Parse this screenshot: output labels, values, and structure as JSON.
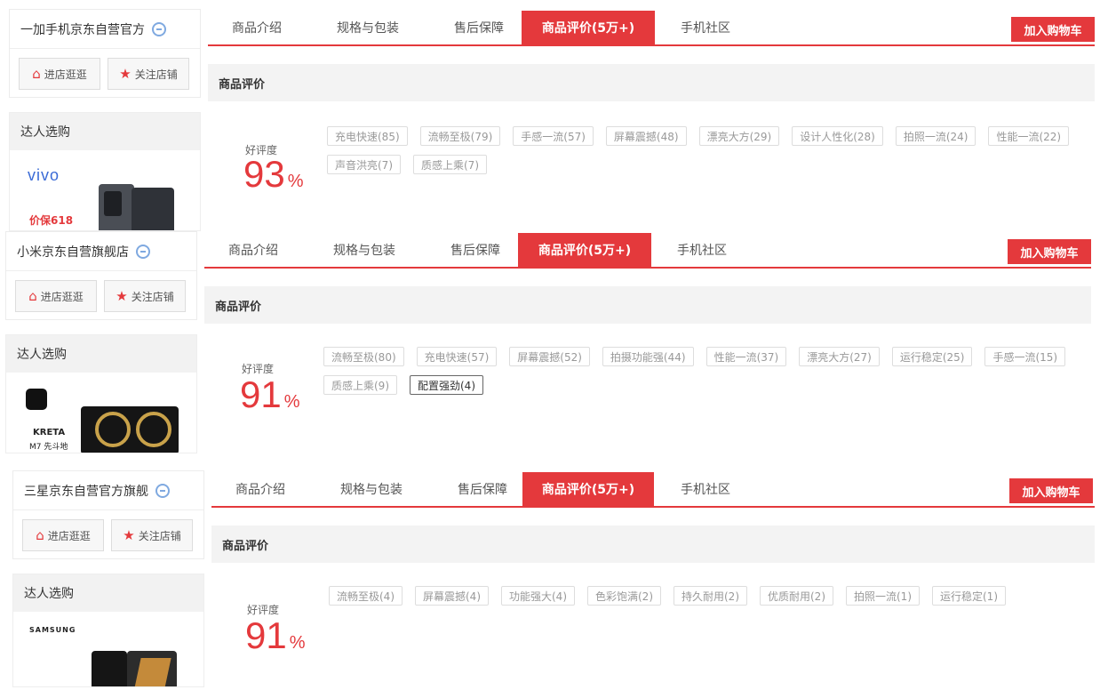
{
  "panels": [
    {
      "shop": {
        "name": "一加手机京东自营官方",
        "btn_enter": "进店逛逛",
        "btn_follow": "关注店铺"
      },
      "daren": {
        "title": "达人选购",
        "brand": "vivo",
        "promo": "价保618"
      },
      "tabs": [
        "商品介绍",
        "规格与包装",
        "售后保障",
        "商品评价(5万+)",
        "手机社区"
      ],
      "cart_label": "加入购物车",
      "section_title": "商品评价",
      "rate_label": "好评度",
      "rate_value": "93",
      "rate_unit": "%",
      "tags": [
        "充电快速(85)",
        "流畅至极(79)",
        "手感一流(57)",
        "屏幕震撼(48)",
        "漂亮大方(29)",
        "设计人性化(28)",
        "拍照一流(24)",
        "性能一流(22)",
        "声音洪亮(7)",
        "质感上乘(7)"
      ]
    },
    {
      "shop": {
        "name": "小米京东自营旗舰店",
        "btn_enter": "进店逛逛",
        "btn_follow": "关注店铺"
      },
      "daren": {
        "title": "达人选购",
        "brand": "KRETA",
        "promo": "M7 先斗地"
      },
      "tabs": [
        "商品介绍",
        "规格与包装",
        "售后保障",
        "商品评价(5万+)",
        "手机社区"
      ],
      "cart_label": "加入购物车",
      "section_title": "商品评价",
      "rate_label": "好评度",
      "rate_value": "91",
      "rate_unit": "%",
      "tags": [
        "流畅至极(80)",
        "充电快速(57)",
        "屏幕震撼(52)",
        "拍摄功能强(44)",
        "性能一流(37)",
        "漂亮大方(27)",
        "运行稳定(25)",
        "手感一流(15)",
        "质感上乘(9)",
        "配置强劲(4)"
      ]
    },
    {
      "shop": {
        "name": "三星京东自营官方旗舰",
        "btn_enter": "进店逛逛",
        "btn_follow": "关注店铺"
      },
      "daren": {
        "title": "达人选购",
        "brand": "SAMSUNG",
        "promo": ""
      },
      "tabs": [
        "商品介绍",
        "规格与包装",
        "售后保障",
        "商品评价(5万+)",
        "手机社区"
      ],
      "cart_label": "加入购物车",
      "section_title": "商品评价",
      "rate_label": "好评度",
      "rate_value": "91",
      "rate_unit": "%",
      "tags": [
        "流畅至极(4)",
        "屏幕震撼(4)",
        "功能强大(4)",
        "色彩饱满(2)",
        "持久耐用(2)",
        "优质耐用(2)",
        "拍照一流(1)",
        "运行稳定(1)"
      ]
    }
  ],
  "colors": {
    "accent": "#e4393c",
    "tag_border": "#dddddd",
    "section_bg": "#f3f3f3"
  },
  "icons": {
    "enter_shop": "home-icon",
    "follow_shop": "star-icon",
    "shop_badge": "shop-chat-icon"
  }
}
